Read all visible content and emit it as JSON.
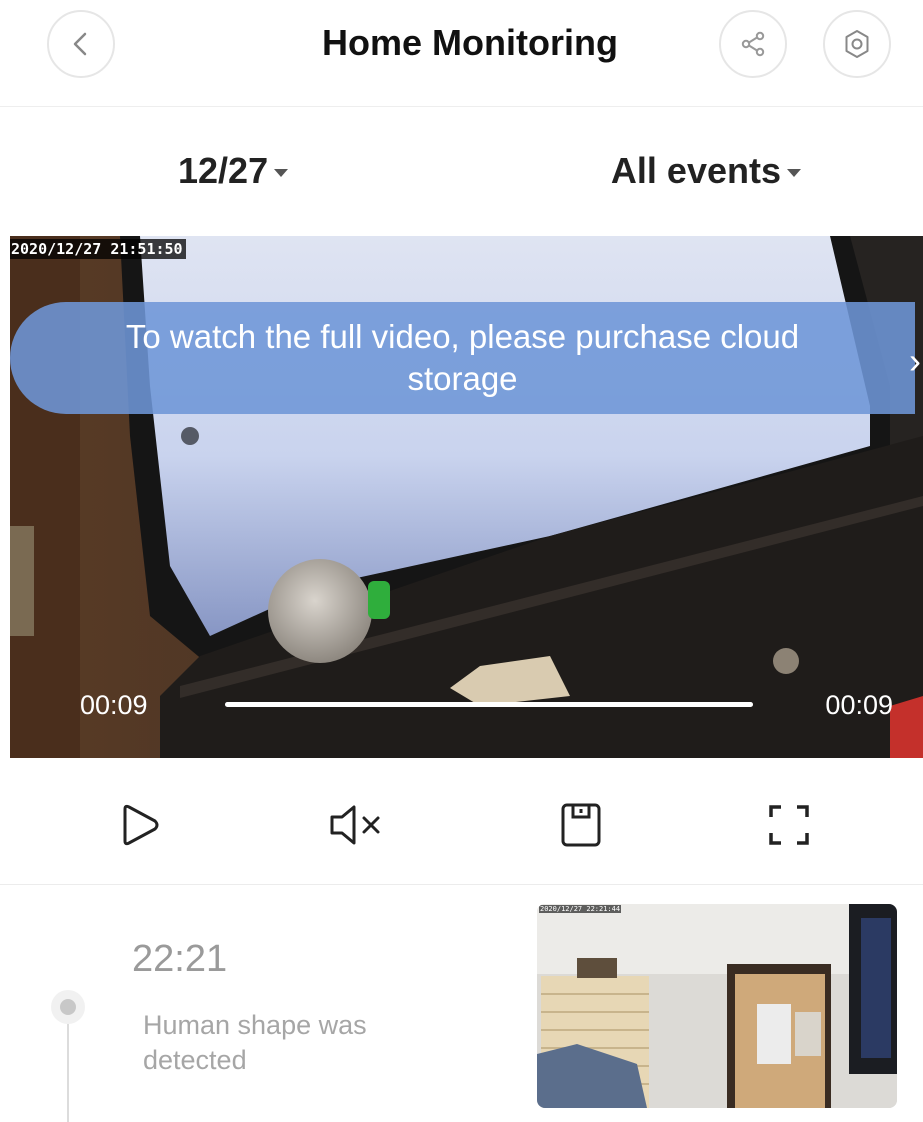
{
  "header": {
    "title": "Home Monitoring",
    "back_icon": "chevron-left-icon",
    "share_icon": "share-icon",
    "settings_icon": "gear-icon"
  },
  "filters": {
    "date": "12/27",
    "events": "All events"
  },
  "player": {
    "timestamp": "2020/12/27  21:51:50",
    "banner_text": "To watch the full video, please purchase cloud storage",
    "current_time": "00:09",
    "total_time": "00:09",
    "progress": 1.0
  },
  "controls": {
    "play_icon": "play-icon",
    "mute_icon": "speaker-muted-icon",
    "save_icon": "save-icon",
    "fullscreen_icon": "fullscreen-icon"
  },
  "events": [
    {
      "time": "22:21",
      "description": "Human shape was detected",
      "thumb_timestamp": "2020/12/27  22:21:44"
    }
  ],
  "colors": {
    "banner": "#6e96d7",
    "text_muted": "#9a9a9a",
    "border": "#e6e6e6"
  }
}
